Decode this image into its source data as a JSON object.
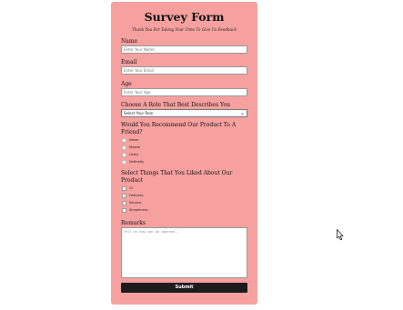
{
  "form": {
    "title": "Survey Form",
    "subtitle": "Thank You For Taking Your Time To Give Us Feedback",
    "name_label": "Name",
    "name_placeholder": "Enter Your Name",
    "email_label": "Email",
    "email_placeholder": "Enter Your Email",
    "age_label": "Age",
    "age_placeholder": "Enter Your Age",
    "role_label": "Choose A Role That Best Describes You",
    "role_selected": "Select Your Role",
    "recommend_label": "Would You Recommend Our Product To A Friend?",
    "recommend_options": [
      "Never",
      "Maybe",
      "Likely",
      "Definetly"
    ],
    "likes_label": "Select Things That You Liked About Our Product",
    "likes_options": [
      "UI",
      "Features",
      "Service",
      "Simpleness"
    ],
    "remarks_label": "Remarks",
    "remarks_placeholder": "Tell us how can we improve..",
    "submit_label": "Submit"
  },
  "colors": {
    "card_bg": "#f7a0a0",
    "submit_bg": "#1c1c1c"
  },
  "icons": {
    "select_chevron": "chevron-down-icon",
    "cursor": "mouse-pointer-icon"
  }
}
